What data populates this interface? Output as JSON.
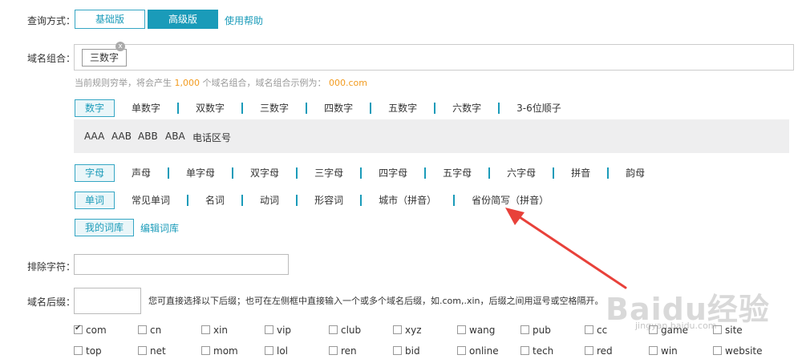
{
  "query_mode": {
    "label": "查询方式：",
    "basic": "基础版",
    "advanced": "高级版",
    "help": "使用帮助"
  },
  "combo": {
    "label": "域名组合：",
    "tag": "三数字",
    "close_glyph": "x"
  },
  "hint": {
    "prefix": "当前规则穷举，将会产生",
    "count": "1,000",
    "middle": "个域名组合，域名组合示例为：",
    "example": "000.com"
  },
  "digits": {
    "active": "数字",
    "items": [
      "单数字",
      "双数字",
      "三数字",
      "四数字",
      "五数字",
      "六数字",
      "3-6位顺子"
    ]
  },
  "patterns": [
    "AAA",
    "AAB",
    "ABB",
    "ABA",
    "电话区号"
  ],
  "letters": {
    "active": "字母",
    "items": [
      "声母",
      "单字母",
      "双字母",
      "三字母",
      "四字母",
      "五字母",
      "六字母",
      "拼音",
      "韵母"
    ]
  },
  "words": {
    "active": "单词",
    "items": [
      "常见单词",
      "名词",
      "动词",
      "形容词",
      "城市（拼音）",
      "省份简写（拼音）"
    ]
  },
  "lexicon": {
    "mine": "我的词库",
    "edit": "编辑词库"
  },
  "exclude": {
    "label": "排除字符：",
    "value": ""
  },
  "suffix": {
    "label": "域名后缀：",
    "note": "您可直接选择以下后缀；也可在左侧框中直接输入一个或多个域名后缀，如.com,.xin，后缀之间用逗号或空格隔开。"
  },
  "tlds_row1": [
    {
      "name": "com",
      "checked": true
    },
    {
      "name": "cn",
      "checked": false
    },
    {
      "name": "xin",
      "checked": false
    },
    {
      "name": "vip",
      "checked": false
    },
    {
      "name": "club",
      "checked": false
    },
    {
      "name": "xyz",
      "checked": false
    },
    {
      "name": "wang",
      "checked": false
    },
    {
      "name": "pub",
      "checked": false
    },
    {
      "name": "cc",
      "checked": false
    },
    {
      "name": "game",
      "checked": false
    },
    {
      "name": "site",
      "checked": false
    }
  ],
  "tlds_row2": [
    {
      "name": "top",
      "checked": false
    },
    {
      "name": "net",
      "checked": false
    },
    {
      "name": "mom",
      "checked": false
    },
    {
      "name": "lol",
      "checked": false
    },
    {
      "name": "ren",
      "checked": false
    },
    {
      "name": "bid",
      "checked": false
    },
    {
      "name": "online",
      "checked": false
    },
    {
      "name": "tech",
      "checked": false
    },
    {
      "name": "red",
      "checked": false
    },
    {
      "name": "win",
      "checked": false
    },
    {
      "name": "website",
      "checked": false
    }
  ],
  "watermark": {
    "text": "Baidu经验",
    "sub": "jingyan.baidu.com"
  },
  "colors": {
    "accent": "#1a9bb9",
    "arrow": "#e8413a",
    "highlight": "#f29b1f"
  }
}
